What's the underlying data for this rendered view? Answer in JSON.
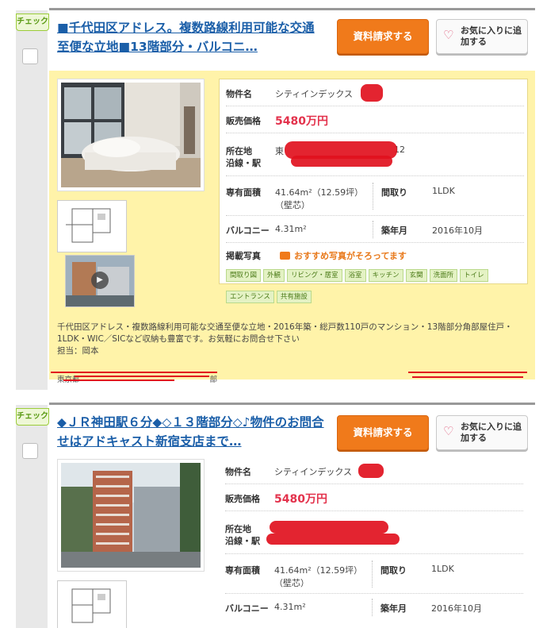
{
  "listings": [
    {
      "check_label": "チェック",
      "title": "■千代田区アドレス。複数路線利用可能な交通至便な立地■13階部分・バルコニ…",
      "request_button": "資料請求する",
      "favorite_button": "お気に入りに追加する",
      "details": {
        "property_name_label": "物件名",
        "property_name": "シティインデックス",
        "price_label": "販売価格",
        "price": "5480万円",
        "location_label_1": "所在地",
        "location_label_2": "沿線・駅",
        "location_value": "東",
        "location_suffix": "12",
        "area_label": "専有面積",
        "area_value": "41.64m²（12.59坪）",
        "area_note": "（壁芯）",
        "layout_label": "間取り",
        "layout_value": "1LDK",
        "balcony_label": "バルコニー",
        "balcony_value": "4.31m²",
        "built_label": "築年月",
        "built_value": "2016年10月",
        "photos_label": "掲載写真",
        "photos_recommend": "おすすめ写真がそろってます",
        "photo_tags": [
          "間取り図",
          "外観",
          "リビング・居室",
          "浴室",
          "キッチン",
          "玄関",
          "洗面所",
          "トイレ",
          "エントランス",
          "共有施設"
        ]
      },
      "description": "千代田区アドレス・複数路線利用可能な交通至便な立地・2016年築・総戸数110戸のマンション・13階部分角部屋住戸・1LDK・WIC／SICなど収納も豊富です。お気軽にお問合せ下さい",
      "contact": "担当：岡本",
      "footer_office": "東京都",
      "footer_office_suffix": "部"
    },
    {
      "check_label": "チェック",
      "title": "◆ＪＲ神田駅６分◆◇１３階部分◇♪物件のお問合せはアドキャスト新宿支店まで…",
      "request_button": "資料請求する",
      "favorite_button": "お気に入りに追加する",
      "details": {
        "property_name_label": "物件名",
        "property_name": "シティインデックス",
        "price_label": "販売価格",
        "price": "5480万円",
        "location_label_1": "所在地",
        "location_label_2": "沿線・駅",
        "area_label": "専有面積",
        "area_value": "41.64m²（12.59坪）",
        "area_note": "（壁芯）",
        "layout_label": "間取り",
        "layout_value": "1LDK",
        "balcony_label": "バルコニー",
        "balcony_value": "4.31m²",
        "built_label": "築年月",
        "built_value": "2016年10月"
      }
    }
  ],
  "colors": {
    "accent_orange": "#f07a1b",
    "link_blue": "#1a5ea8",
    "price_red": "#e3324c",
    "panel_yellow": "#fff3a9",
    "check_green": "#9ccc3a",
    "redaction_red": "#e1111e"
  },
  "icons": [
    "heart-icon",
    "camera-icon",
    "play-icon"
  ]
}
